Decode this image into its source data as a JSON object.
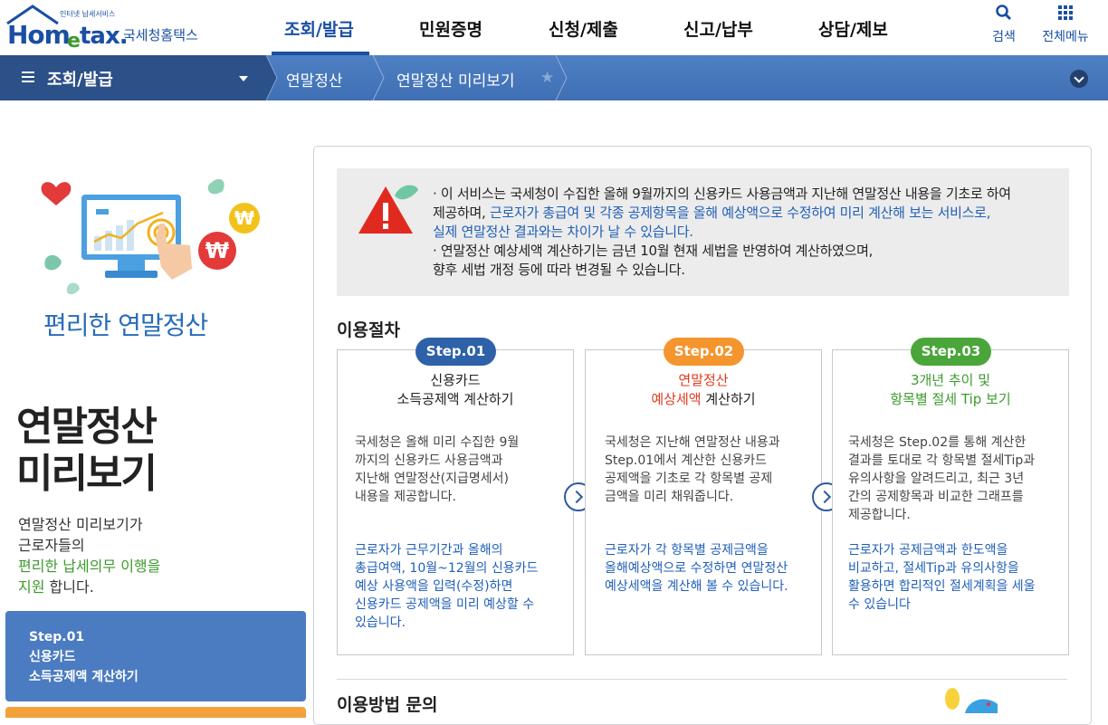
{
  "header": {
    "logo": {
      "small_text": "인터넷 납세서비스",
      "brand": "Hometax",
      "name": "국세청홈택스"
    },
    "nav": [
      {
        "label": "조회/발급",
        "active": true
      },
      {
        "label": "민원증명",
        "active": false
      },
      {
        "label": "신청/제출",
        "active": false
      },
      {
        "label": "신고/납부",
        "active": false
      },
      {
        "label": "상담/제보",
        "active": false
      }
    ],
    "search_label": "검색",
    "allmenu_label": "전체메뉴"
  },
  "location": {
    "menu_label": "조회/발급",
    "crumb1": "연말정산",
    "crumb2": "연말정산 미리보기"
  },
  "left": {
    "heading": "편리한 연말정산",
    "title_line1": "연말정산",
    "title_line2": "미리보기",
    "desc_line1": "연말정산 미리보기가",
    "desc_line2": "근로자들의",
    "desc_line3_green": "편리한 납세의무 이행을",
    "desc_line4_green": "지원",
    "desc_line4_rest": " 합니다.",
    "step_button": {
      "line1": "Step.01",
      "line2": "신용카드",
      "line3": "소득공제액 계산하기"
    }
  },
  "notice": {
    "line1": "· 이 서비스는 국세청이 수집한 올해 9월까지의 신용카드 사용금액과 지난해 연말정산 내용을 기초로 하여",
    "line2_a": "제공하며, ",
    "line2_b": "근로자가 총급여 및 각종 공제항목을 올해 예상액으로 수정하여 미리 계산해 보는 서비스로,",
    "line3": "실제 연말정산 결과와는 차이가 날 수 있습니다.",
    "line4": "· 연말정산 예상세액 계산하기는 금년 10월 현재 세법을 반영하여 계산하였으며,",
    "line5": "향후 세법 개정 등에 따라 변경될 수 있습니다."
  },
  "procedure": {
    "title": "이용절차",
    "steps": [
      {
        "badge": "Step.01",
        "title_line1": "신용카드",
        "title_line2": "소득공제액 계산하기",
        "body": [
          "국세청은 올해 미리 수집한 9월",
          "까지의 신용카드 사용금액과",
          "지난해 연말정산(지급명세서)",
          "내용을 제공합니다."
        ],
        "note": [
          "근로자가 근무기간과 올해의",
          "총급여액, 10월~12월의 신용카드",
          "예상 사용액을 입력(수정)하면",
          "신용카드 공제액을 미리 예상할 수",
          "있습니다."
        ]
      },
      {
        "badge": "Step.02",
        "title_line1": "연말정산",
        "title_line2_hl": "예상세액",
        "title_line2_rest": " 계산하기",
        "body": [
          "국세청은 지난해 연말정산 내용과",
          "Step.01에서 계산한 신용카드",
          "공제액을 기초로 각 항목별 공제",
          "금액을 미리 채워줍니다."
        ],
        "note": [
          "근로자가 각 항목별 공제금액을",
          "올해예상액으로 수정하면 연말정산",
          "예상세액을 계산해 볼 수 있습니다."
        ]
      },
      {
        "badge": "Step.03",
        "title_line1": "3개년 추이 및",
        "title_line2": "항목별 절세 Tip 보기",
        "body": [
          "국세청은 Step.02를 통해 계산한",
          "결과를 토대로 각 항목별 절세Tip과",
          "유의사항을 알려드리고, 최근 3년",
          "간의 공제항목과 비교한 그래프를",
          "제공합니다."
        ],
        "note": [
          "근로자가 공제금액과 한도액을",
          "비교하고, 절세Tip과 유의사항을",
          "활용하면 합리적인 절세계획을 세울",
          "수 있습니다"
        ]
      }
    ]
  },
  "inquiry": {
    "title": "이용방법 문의"
  },
  "colors": {
    "brand_blue": "#1a4fa3",
    "step1": "#2f61a9",
    "step2": "#f5952e",
    "step3": "#4aa63a",
    "step2_title": "#e03a1e",
    "step3_title": "#3c9a2d",
    "highlight_blue": "#1f5fb7"
  }
}
